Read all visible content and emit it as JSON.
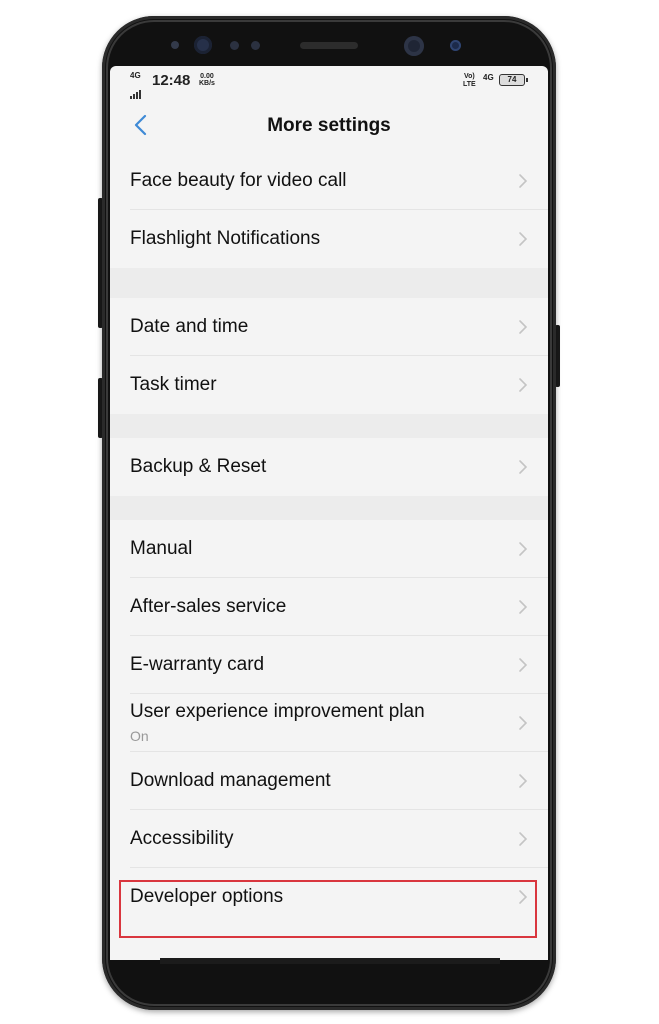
{
  "status_bar": {
    "network_left": "4G",
    "time": "12:48",
    "net_speed_value": "0.00",
    "net_speed_unit": "KB/s",
    "volte_top": "Vo)",
    "volte_bottom": "LTE",
    "network_right": "4G",
    "battery": "74"
  },
  "header": {
    "back_icon": "chevron-left-icon",
    "title": "More settings"
  },
  "groups": [
    {
      "items": [
        {
          "label": "Face beauty for video call",
          "icon": "chevron-right-icon"
        },
        {
          "label": "Flashlight Notifications",
          "icon": "chevron-right-icon"
        }
      ]
    },
    {
      "items": [
        {
          "label": "Date and time",
          "icon": "chevron-right-icon"
        },
        {
          "label": "Task timer",
          "icon": "chevron-right-icon"
        }
      ]
    },
    {
      "items": [
        {
          "label": "Backup & Reset",
          "icon": "chevron-right-icon"
        }
      ]
    },
    {
      "items": [
        {
          "label": "Manual",
          "icon": "chevron-right-icon"
        },
        {
          "label": "After-sales service",
          "icon": "chevron-right-icon"
        },
        {
          "label": "E-warranty card",
          "icon": "chevron-right-icon"
        },
        {
          "label": "User experience improvement plan",
          "sub": "On",
          "icon": "chevron-right-icon"
        },
        {
          "label": "Download management",
          "icon": "chevron-right-icon"
        },
        {
          "label": "Accessibility",
          "icon": "chevron-right-icon"
        },
        {
          "label": "Developer options",
          "icon": "chevron-right-icon",
          "highlighted": true
        }
      ]
    }
  ],
  "colors": {
    "accent": "#3f8ad6",
    "highlight_border": "#d9363e",
    "screen_bg": "#f4f4f4",
    "group_gap_bg": "#ececec"
  }
}
